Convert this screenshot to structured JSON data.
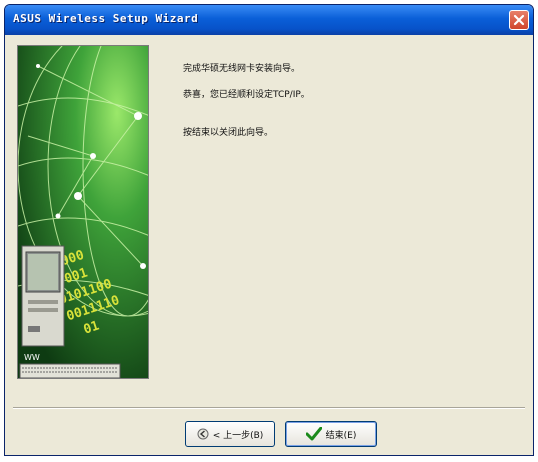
{
  "window": {
    "title": "ASUS Wireless Setup Wizard"
  },
  "banner": {
    "binary_rows": [
      "10000",
      "100001",
      "00101100",
      "0011110",
      "01"
    ],
    "keyboard_label": "WW"
  },
  "content": {
    "line1": "完成华硕无线网卡安装向导。",
    "line2": "恭喜，您已经顺利设定TCP/IP。",
    "line3": "按结束以关闭此向导。"
  },
  "buttons": {
    "back_label": "< 上一步(B)",
    "finish_label": "结束(E)"
  },
  "icons": {
    "back": "back-arrow-icon",
    "finish": "checkmark-icon",
    "close": "close-icon"
  },
  "colors": {
    "titlebar": "#0a5fd8",
    "dialog_bg": "#ece9d8",
    "banner_green": "#1b5a1b",
    "binary_yellow": "#d8e23a",
    "close_red": "#d0452c"
  }
}
